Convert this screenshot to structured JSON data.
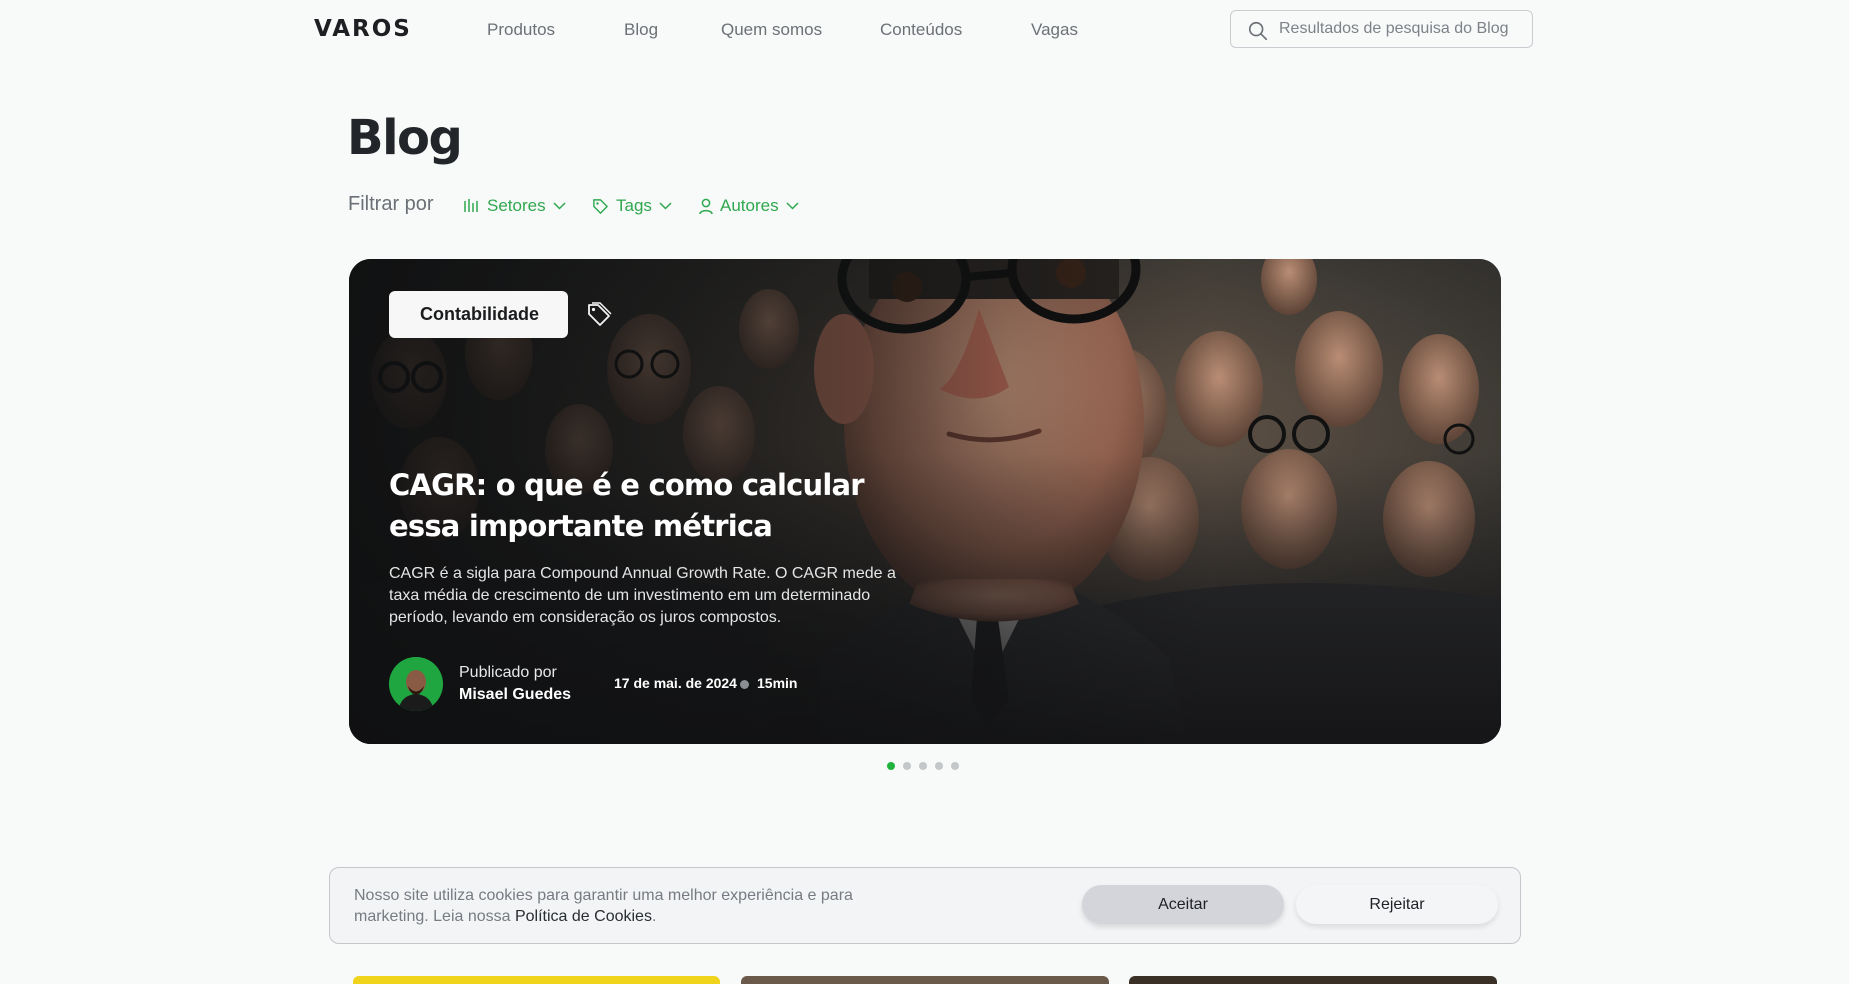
{
  "header": {
    "logo": "VAROS",
    "nav": [
      "Produtos",
      "Blog",
      "Quem somos",
      "Conteúdos",
      "Vagas"
    ],
    "search_placeholder": "Resultados de pesquisa do Blog"
  },
  "page": {
    "title": "Blog",
    "filter_label": "Filtrar por",
    "filters": [
      "Setores",
      "Tags",
      "Autores"
    ]
  },
  "hero": {
    "category": "Contabilidade",
    "title": "CAGR: o que é e como calcular essa importante métrica",
    "description": "CAGR é a sigla para Compound Annual Growth Rate. O CAGR mede a taxa média de crescimento de um investimento em um determinado período, levando em consideração os juros compostos.",
    "published_label": "Publicado por",
    "author": "Misael Guedes",
    "date": "17 de mai. de 2024",
    "read_time": "15min"
  },
  "carousel": {
    "slides": 5,
    "active": 1
  },
  "cookie": {
    "text": "Nosso site utiliza cookies para garantir uma melhor experiência e para marketing. Leia nossa ",
    "link": "Política de Cookies",
    "suffix": ".",
    "accept": "Aceitar",
    "reject": "Rejeitar"
  },
  "colors": {
    "accent": "#2fa84f",
    "dot_active": "#22b33f",
    "thumb_1": "#f0d31b",
    "thumb_2": "#6b5a4a",
    "thumb_3": "#3a3026"
  }
}
